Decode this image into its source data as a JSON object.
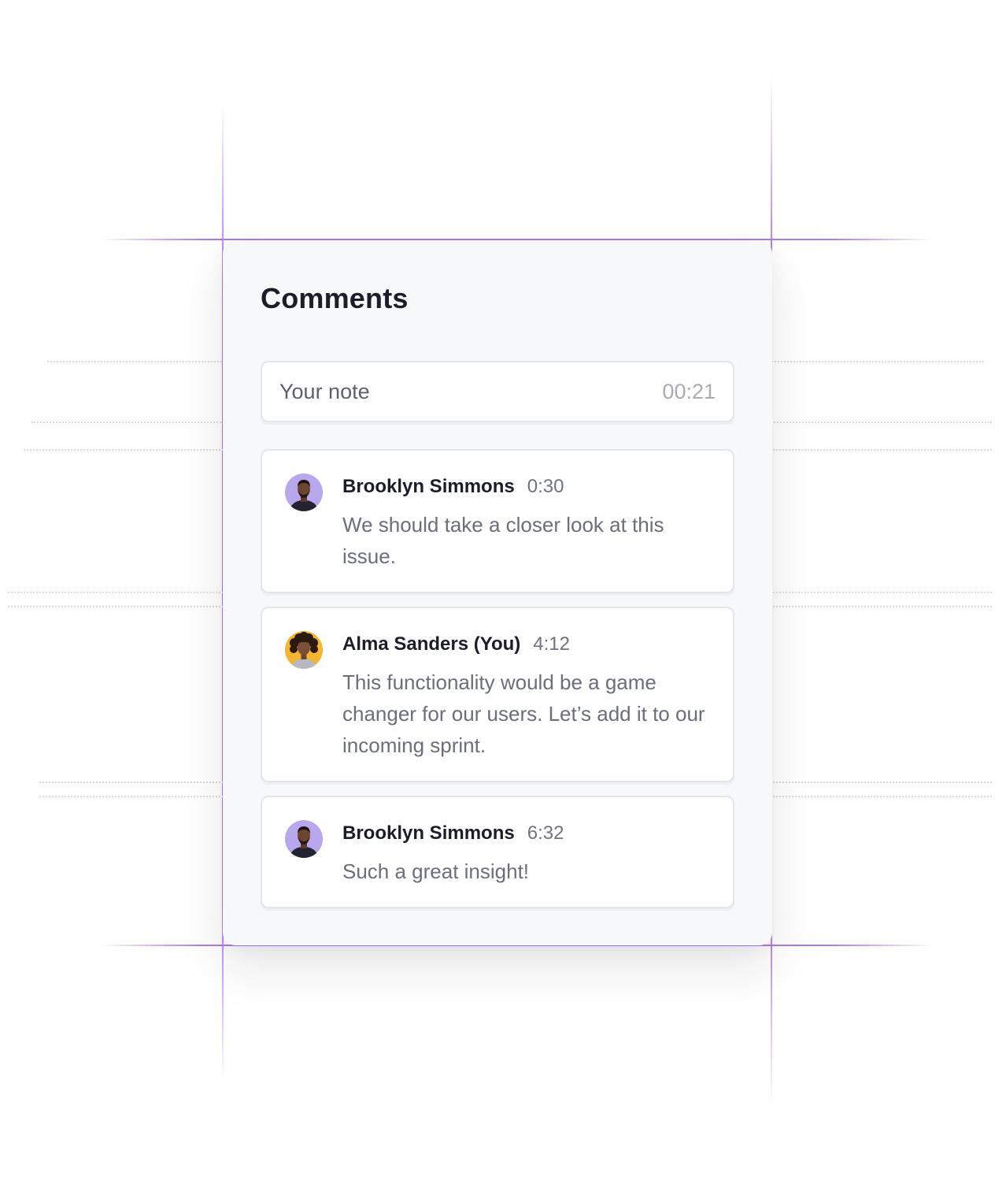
{
  "panel": {
    "title": "Comments"
  },
  "note": {
    "placeholder": "Your note",
    "timestamp": "00:21"
  },
  "comments": [
    {
      "author": "Brooklyn Simmons",
      "time": "0:30",
      "text": "We should take a closer look at this issue."
    },
    {
      "author": "Alma Sanders (You)",
      "time": "4:12",
      "text": "This functionality would be a game changer for our users. Let’s add it to our incoming sprint."
    },
    {
      "author": "Brooklyn Simmons",
      "time": "6:32",
      "text": "Such a great insight!"
    }
  ],
  "colors": {
    "accent_guides": "#b076f0",
    "panel_background": "#f7f8f9",
    "title_text": "#1b1d2a",
    "body_text": "#6b6e7b"
  }
}
